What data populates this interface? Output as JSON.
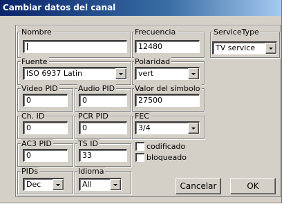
{
  "window": {
    "title": "Cambiar datos del canal"
  },
  "fields": {
    "nombre": {
      "label": "Nombre",
      "value": ""
    },
    "frecuencia": {
      "label": "Frecuencia",
      "value": "12480"
    },
    "service_type": {
      "label": "ServiceType",
      "value": "TV service"
    },
    "fuente": {
      "label": "Fuente",
      "value": "ISO 6937 Latin"
    },
    "polaridad": {
      "label": "Polaridad",
      "value": "vert"
    },
    "video_pid": {
      "label": "Video PID",
      "value": "0"
    },
    "audio_pid": {
      "label": "Audio PID",
      "value": "0"
    },
    "valor_simbolo": {
      "label": "Valor del símbolo",
      "value": "27500"
    },
    "ch_id": {
      "label": "Ch. ID",
      "value": "0"
    },
    "pcr_pid": {
      "label": "PCR PID",
      "value": "0"
    },
    "fec": {
      "label": "FEC",
      "value": "3/4"
    },
    "ac3_pid": {
      "label": "AC3 PID",
      "value": "0"
    },
    "ts_id": {
      "label": "TS ID",
      "value": "33"
    },
    "pids": {
      "label": "PIDs",
      "value": "Dec"
    },
    "idioma": {
      "label": "Idioma",
      "value": "All"
    }
  },
  "checkboxes": {
    "codificado": {
      "label": "codificado",
      "checked": false
    },
    "bloqueado": {
      "label": "bloqueado",
      "checked": false
    }
  },
  "buttons": {
    "cancel": "Cancelar",
    "ok": "OK"
  }
}
